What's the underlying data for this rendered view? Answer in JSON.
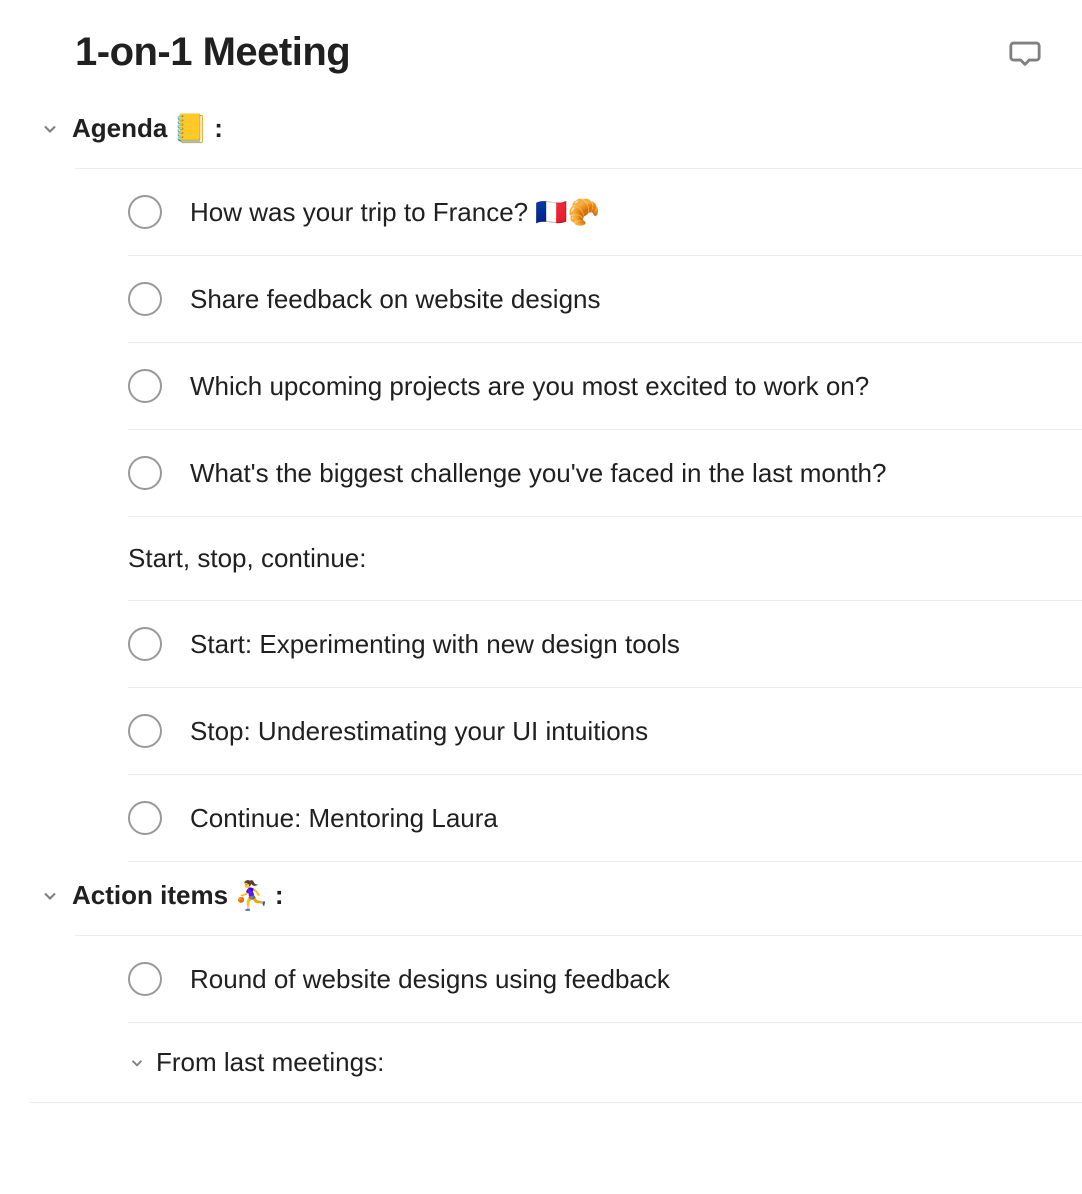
{
  "title": "1-on-1 Meeting",
  "sections": {
    "agenda": {
      "label": "Agenda",
      "emoji": "📒",
      "colon": ":",
      "items": [
        "How was your trip to France? 🇫🇷🥐",
        "Share feedback on website designs",
        "Which upcoming projects are you most excited to work on?",
        "What's the biggest challenge you've faced in the last month?"
      ],
      "subheader": "Start, stop, continue:",
      "ssc_items": [
        "Start: Experimenting with new design tools",
        "Stop: Underestimating your UI intuitions",
        "Continue: Mentoring Laura"
      ]
    },
    "action": {
      "label": "Action items",
      "emoji": "⛹️‍♀️",
      "colon": ":",
      "items": [
        "Round of website designs using feedback"
      ],
      "sub_section_label": "From last meetings:"
    }
  }
}
